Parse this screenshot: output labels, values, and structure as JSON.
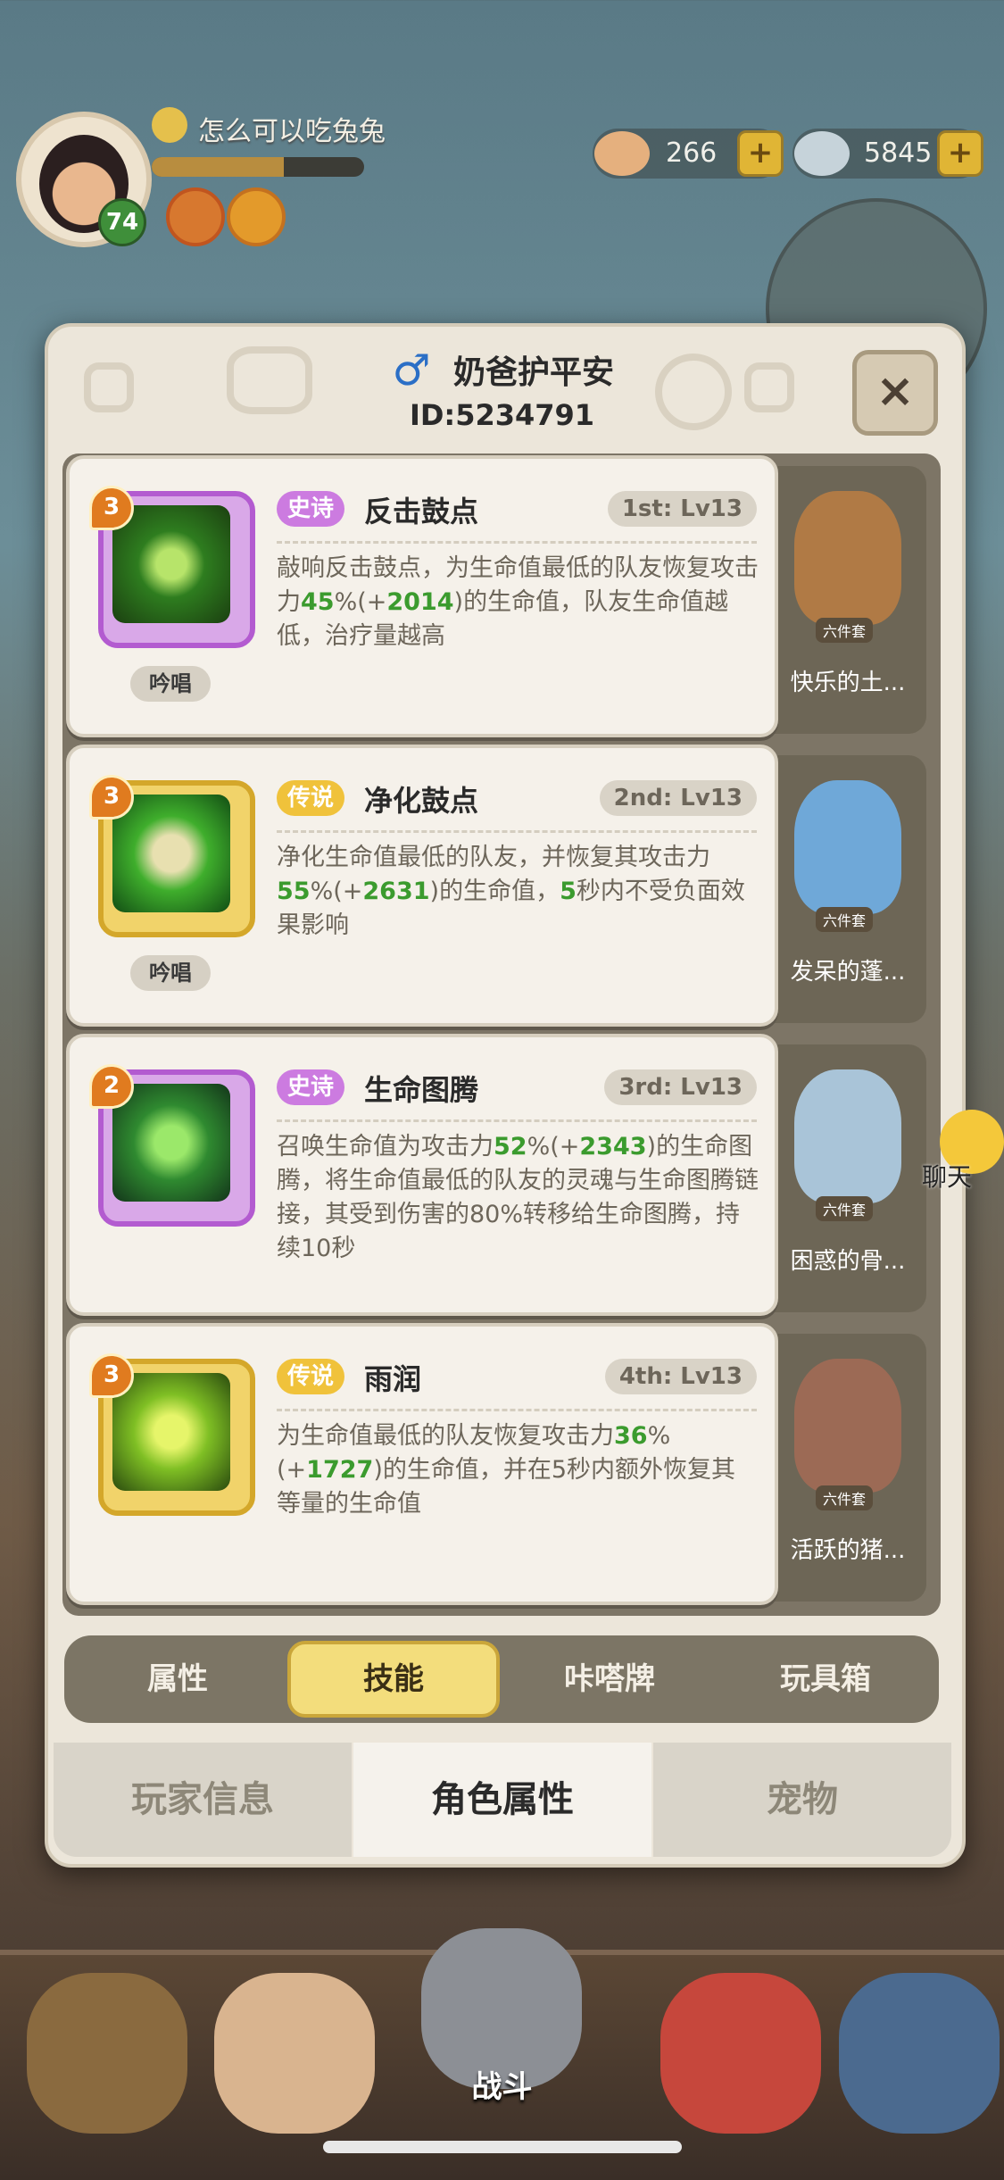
{
  "player": {
    "name": "怎么可以吃兔兔",
    "level": "74",
    "exp_fraction": 0.62
  },
  "resources": [
    {
      "icon": "shell-coin-icon",
      "value": "266"
    },
    {
      "icon": "pearl-icon",
      "value": "5845"
    }
  ],
  "chat": {
    "label": "聊天"
  },
  "modal": {
    "gender": "♂",
    "name": "奶爸护平安",
    "id": "ID:5234791",
    "close": "×"
  },
  "skills": [
    {
      "level_gem": "3",
      "rarity": "史诗",
      "rarity_type": "epic",
      "name": "反击鼓点",
      "rank": "1st: Lv13",
      "desc_parts": [
        "敲响反击鼓点，为生命值最低的队友恢复攻击力",
        "45",
        "%(+",
        "2014",
        ")的生命值，队友生命值越低，治疗量越高"
      ],
      "tag": "吟唱",
      "pet_name": "快乐的土...",
      "set_tag": "六件套"
    },
    {
      "level_gem": "3",
      "rarity": "传说",
      "rarity_type": "legend",
      "name": "净化鼓点",
      "rank": "2nd: Lv13",
      "desc_parts": [
        "净化生命值最低的队友，并恢复其攻击力",
        "55",
        "%(+",
        "2631",
        ")的生命值，",
        "5",
        "秒内不受负面效果影响"
      ],
      "tag": "吟唱",
      "pet_name": "发呆的蓬...",
      "set_tag": "六件套"
    },
    {
      "level_gem": "2",
      "rarity": "史诗",
      "rarity_type": "epic",
      "name": "生命图腾",
      "rank": "3rd: Lv13",
      "desc_parts": [
        "召唤生命值为攻击力",
        "52",
        "%(+",
        "2343",
        ")的生命图腾，将生命值最低的队友的灵魂与生命图腾链接，其受到伤害的80%转移给生命图腾，持续10秒"
      ],
      "tag": "",
      "pet_name": "困惑的骨...",
      "set_tag": "六件套"
    },
    {
      "level_gem": "3",
      "rarity": "传说",
      "rarity_type": "legend",
      "name": "雨润",
      "rank": "4th: Lv13",
      "desc_parts": [
        "为生命值最低的队友恢复攻击力",
        "36",
        "%(+",
        "1727",
        ")的生命值，并在5秒内额外恢复其等量的生命值"
      ],
      "tag": "",
      "pet_name": "活跃的猪...",
      "set_tag": "六件套"
    }
  ],
  "subtabs": [
    {
      "label": "属性",
      "active": false
    },
    {
      "label": "技能",
      "active": true
    },
    {
      "label": "咔嗒牌",
      "active": false
    },
    {
      "label": "玩具箱",
      "active": false
    }
  ],
  "main_tabs": [
    {
      "label": "玩家信息",
      "active": false
    },
    {
      "label": "角色属性",
      "active": true
    },
    {
      "label": "宠物",
      "active": false
    }
  ],
  "bottom_nav": {
    "battle_label": "战斗"
  },
  "colors": {
    "epic": "#cc7be0",
    "legend": "#f0c23b",
    "highlight_green": "#3b9b2e",
    "active_tab": "#f3dd7c"
  }
}
